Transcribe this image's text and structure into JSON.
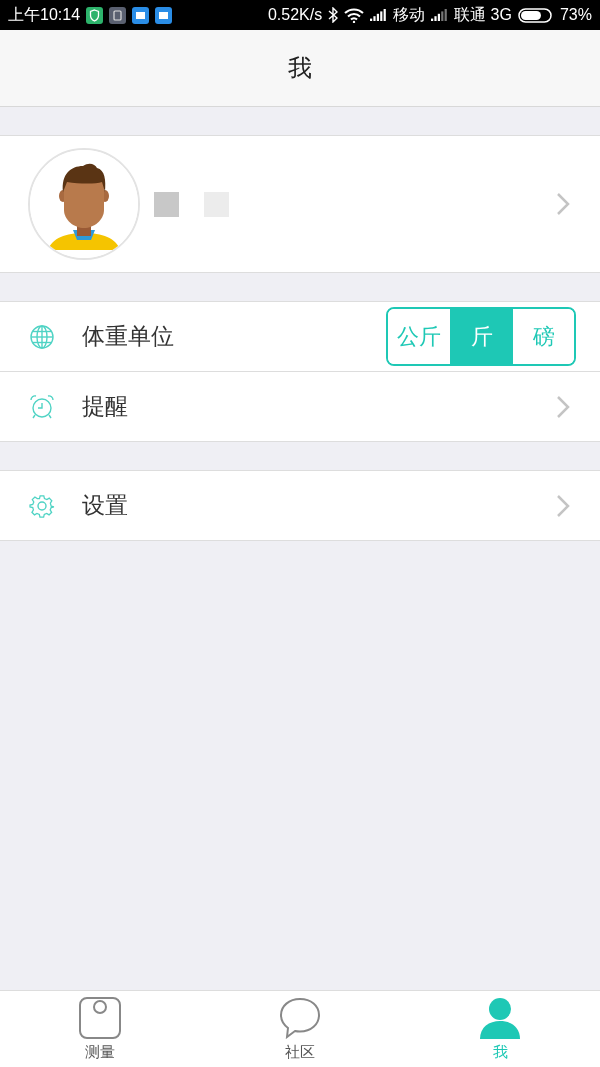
{
  "status_bar": {
    "time": "上午10:14",
    "speed": "0.52K/s",
    "carrier_1": "移动",
    "carrier_2": "联通 3G",
    "battery": "73%"
  },
  "header": {
    "title": "我"
  },
  "profile": {
    "kind": "avatar"
  },
  "groups": [
    {
      "rows": [
        {
          "kind": "segment",
          "label": "体重单位",
          "options": [
            {
              "label": "公斤",
              "selected": false
            },
            {
              "label": "斤",
              "selected": true
            },
            {
              "label": "磅",
              "selected": false
            }
          ]
        },
        {
          "kind": "link",
          "label": "提醒"
        }
      ]
    },
    {
      "rows": [
        {
          "kind": "link",
          "label": "设置"
        }
      ]
    }
  ],
  "tabs": [
    {
      "label": "测量",
      "selected": false
    },
    {
      "label": "社区",
      "selected": false
    },
    {
      "label": "我",
      "selected": true
    }
  ]
}
